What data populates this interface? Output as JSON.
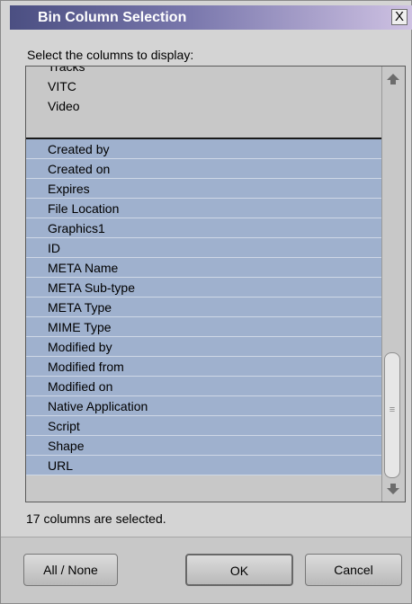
{
  "window": {
    "title": "Bin Column Selection",
    "close_symbol": "X"
  },
  "prompt": "Select the columns to display:",
  "list": {
    "unselected_items": [
      "Tracks",
      "VITC",
      "Video"
    ],
    "selected_items": [
      "Created by",
      "Created on",
      "Expires",
      "File Location",
      "Graphics1",
      "ID",
      "META Name",
      "META Sub-type",
      "META Type",
      "MIME Type",
      "Modified by",
      "Modified from",
      "Modified on",
      "Native Application",
      "Script",
      "Shape",
      "URL"
    ]
  },
  "scrollbar": {
    "up_icon": "arrow-up-icon",
    "down_icon": "arrow-down-icon",
    "thumb_grip_icon": "grip-icon"
  },
  "status": "17 columns are selected.",
  "buttons": {
    "all_none": "All / None",
    "ok": "OK",
    "cancel": "Cancel"
  },
  "colors": {
    "selected_row": "#9fb1ce",
    "title_gradient_start": "#4b4f82",
    "title_gradient_end": "#cfc2e3"
  }
}
